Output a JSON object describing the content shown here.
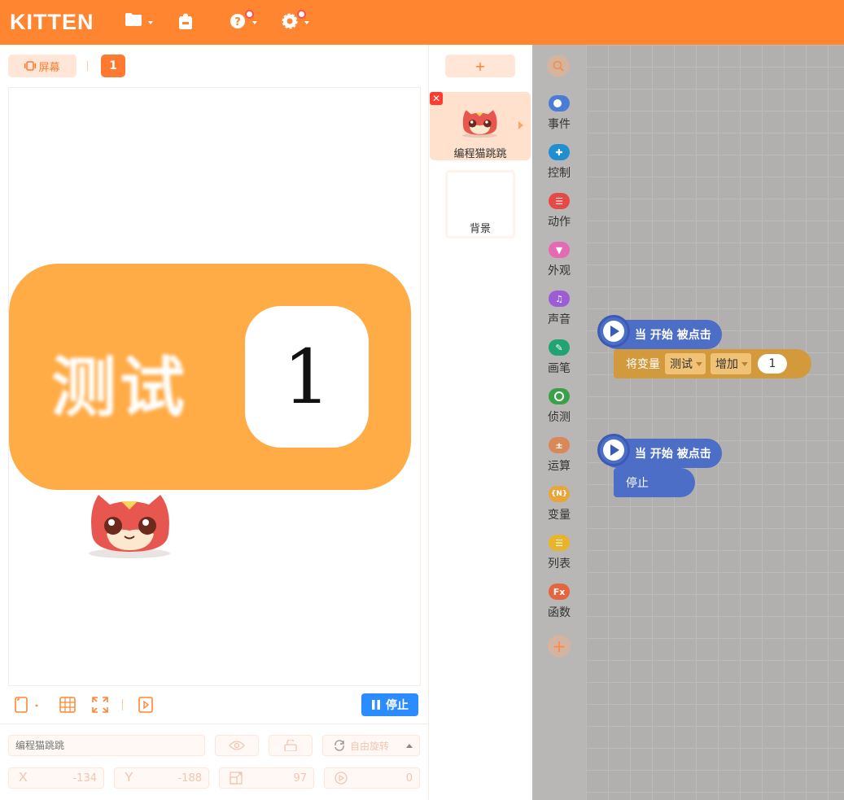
{
  "app": {
    "logo": "KITTEN"
  },
  "toolbar": {
    "icons": [
      "folder-icon",
      "backpack-icon",
      "help-icon",
      "settings-icon"
    ]
  },
  "stage_panel": {
    "screen_button": "屏幕",
    "scene_number": "1",
    "variable_monitor": {
      "name": "测试",
      "value": "1"
    },
    "stop_button": "停止"
  },
  "properties": {
    "sprite_name_placeholder": "编程猫跳跳",
    "rotation_mode": "自由旋转",
    "x_label": "X",
    "x_value": "-134",
    "y_label": "Y",
    "y_value": "-188",
    "size_value": "97",
    "direction_value": "0"
  },
  "sprites": {
    "add_button": "+",
    "items": [
      {
        "name": "编程猫跳跳"
      }
    ],
    "background_label": "背景"
  },
  "categories": [
    {
      "label": "事件",
      "color": "#4a7bd6"
    },
    {
      "label": "控制",
      "color": "#1f8fd1"
    },
    {
      "label": "动作",
      "color": "#e64a47"
    },
    {
      "label": "外观",
      "color": "#e46ab3"
    },
    {
      "label": "声音",
      "color": "#9a5dd6"
    },
    {
      "label": "画笔",
      "color": "#21a374"
    },
    {
      "label": "侦测",
      "color": "#3aa04a"
    },
    {
      "label": "运算",
      "color": "#d9885a"
    },
    {
      "label": "变量",
      "color": "#e9a53a",
      "glyph": "{N}"
    },
    {
      "label": "列表",
      "color": "#e8b52a"
    },
    {
      "label": "函数",
      "color": "#e7643c",
      "glyph": "Fx"
    }
  ],
  "blocks": {
    "hat_label": "当 开始 被点击",
    "var_block": {
      "prefix": "将变量",
      "variable": "测试",
      "operation": "增加",
      "value": "1"
    },
    "stop_label": "停止"
  },
  "colors": {
    "accent": "#ff8530",
    "primary_blue": "#2b8cff",
    "event_block": "#4d6ec6",
    "variable_block": "#d39a3d"
  }
}
